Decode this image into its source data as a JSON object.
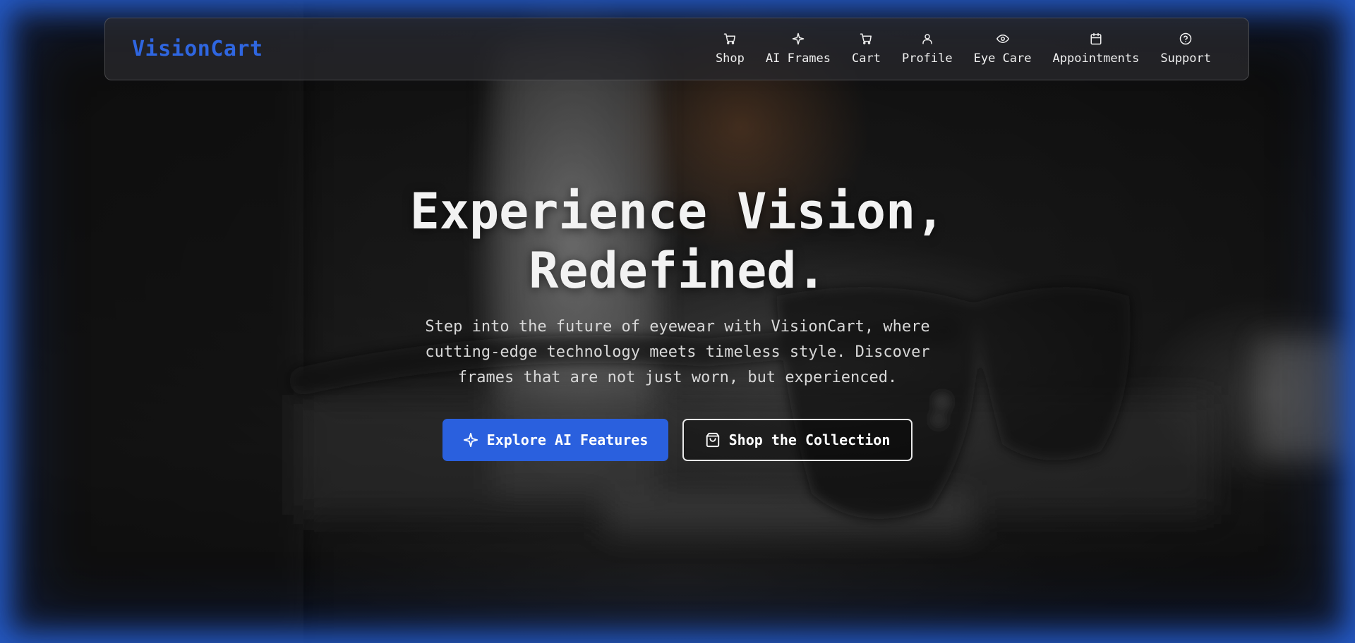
{
  "brand": {
    "name": "VisionCart",
    "color": "#2f66e0"
  },
  "nav": {
    "items": [
      {
        "label": "Shop",
        "icon": "cart-icon"
      },
      {
        "label": "AI Frames",
        "icon": "sparkle-icon"
      },
      {
        "label": "Cart",
        "icon": "cart-icon"
      },
      {
        "label": "Profile",
        "icon": "user-icon"
      },
      {
        "label": "Eye Care",
        "icon": "eye-icon"
      },
      {
        "label": "Appointments",
        "icon": "calendar-icon"
      },
      {
        "label": "Support",
        "icon": "help-circle-icon"
      }
    ]
  },
  "hero": {
    "title_line1": "Experience Vision,",
    "title_line2": "Redefined.",
    "subtitle": "Step into the future of eyewear with VisionCart, where cutting-edge technology meets timeless style. Discover frames that are not just worn, but experienced.",
    "primary_cta": {
      "label": "Explore AI Features",
      "icon": "sparkle-icon",
      "color": "#2a60de"
    },
    "secondary_cta": {
      "label": "Shop the Collection",
      "icon": "shopping-bag-icon"
    }
  },
  "theme": {
    "accent": "#2a60de",
    "edge_glow": "#2864dc"
  }
}
